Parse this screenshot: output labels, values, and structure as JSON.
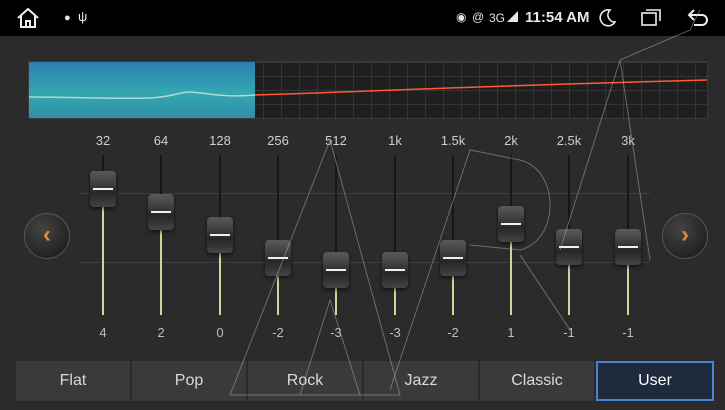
{
  "status_bar": {
    "network": "3G",
    "time": "11:54 AM",
    "icons": [
      "home-icon",
      "android-icon",
      "usb-icon",
      "location-icon",
      "hotspot-icon",
      "signal-icon",
      "moon-icon",
      "window-icon",
      "back-icon"
    ]
  },
  "equalizer": {
    "bands": [
      {
        "freq": "32",
        "value": "4",
        "level": 4
      },
      {
        "freq": "64",
        "value": "2",
        "level": 2
      },
      {
        "freq": "128",
        "value": "0",
        "level": 0
      },
      {
        "freq": "256",
        "value": "-2",
        "level": -2
      },
      {
        "freq": "512",
        "value": "-3",
        "level": -3
      },
      {
        "freq": "1k",
        "value": "-3",
        "level": -3
      },
      {
        "freq": "1.5k",
        "value": "-2",
        "level": -2
      },
      {
        "freq": "2k",
        "value": "1",
        "level": 1
      },
      {
        "freq": "2.5k",
        "value": "-1",
        "level": -1
      },
      {
        "freq": "3k",
        "value": "-1",
        "level": -1
      }
    ],
    "nav": {
      "prev_icon": "chevron-left-icon",
      "next_icon": "chevron-right-icon"
    }
  },
  "presets": [
    {
      "label": "Flat",
      "active": false
    },
    {
      "label": "Pop",
      "active": false
    },
    {
      "label": "Rock",
      "active": false
    },
    {
      "label": "Jazz",
      "active": false
    },
    {
      "label": "Classic",
      "active": false
    },
    {
      "label": "User",
      "active": true
    }
  ],
  "colors": {
    "accent": "#e08a3a",
    "selected_border": "#4a82d6",
    "curve": "#ff5a36",
    "slider_fill": "#d8d296"
  }
}
